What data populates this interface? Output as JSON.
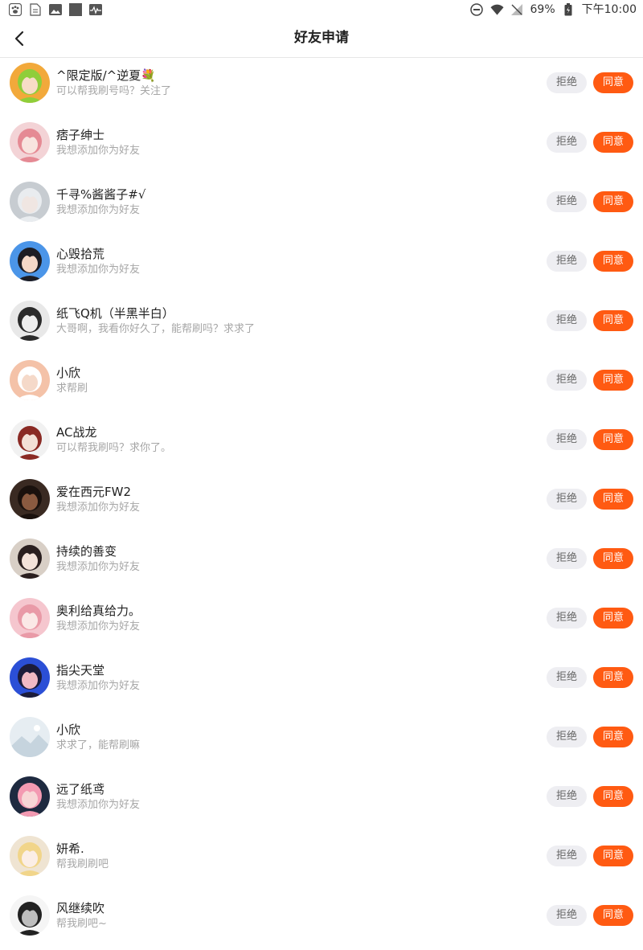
{
  "status_bar": {
    "left_icons": [
      "paw-app-icon",
      "document-icon",
      "image-icon",
      "gray-square-icon",
      "activity-icon"
    ],
    "right_icons": [
      "do-not-disturb-icon",
      "wifi-icon",
      "no-sim-icon",
      "battery-icon"
    ],
    "battery": "69%",
    "time": "下午10:00"
  },
  "header": {
    "title": "好友申请",
    "back_icon": "chevron-left-icon"
  },
  "buttons": {
    "reject_label": "拒绝",
    "accept_label": "同意"
  },
  "colors": {
    "accent": "#ff5a12",
    "reject_bg": "#eeeef2",
    "name_text": "#222222",
    "message_text": "#a6a6a6"
  },
  "requests": [
    {
      "name": "^限定版/^逆夏💐",
      "message": "可以帮我刷号吗？关注了",
      "avatar": "green-haired-anime-avatar"
    },
    {
      "name": "痞子绅士",
      "message": "我想添加你为好友",
      "avatar": "pink-anime-avatar"
    },
    {
      "name": "千寻%酱酱子#√",
      "message": "我想添加你为好友",
      "avatar": "white-haired-anime-avatar"
    },
    {
      "name": "心毁拾荒",
      "message": "我想添加你为好友",
      "avatar": "black-haired-girl-avatar"
    },
    {
      "name": "纸飞Q机（半黑半白）",
      "message": "大哥啊，我看你好久了，能帮刷吗？求求了",
      "avatar": "masked-boy-avatar"
    },
    {
      "name": "小欣",
      "message": "求帮刷",
      "avatar": "bear-hat-avatar"
    },
    {
      "name": "AC战龙",
      "message": "可以帮我刷吗？求你了。",
      "avatar": "red-white-hair-avatar"
    },
    {
      "name": "爱在西元FW2",
      "message": "我想添加你为好友",
      "avatar": "dark-skin-girl-avatar"
    },
    {
      "name": "持续的善变",
      "message": "我想添加你为好友",
      "avatar": "dark-haired-boy-avatar"
    },
    {
      "name": "奥利给真给力。",
      "message": "我想添加你为好友",
      "avatar": "pink-haired-girl-avatar"
    },
    {
      "name": "指尖天堂",
      "message": "我想添加你为好友",
      "avatar": "blue-pink-girl-avatar"
    },
    {
      "name": "小欣",
      "message": "求求了，能帮刷嘛",
      "avatar": "default-landscape-avatar"
    },
    {
      "name": "远了纸鸢",
      "message": "我想添加你为好友",
      "avatar": "pink-haired-dark-avatar"
    },
    {
      "name": "妍希.",
      "message": "帮我刷刷吧",
      "avatar": "blonde-girl-avatar"
    },
    {
      "name": "风继续吹",
      "message": "帮我刷吧~",
      "avatar": "black-white-figure-avatar"
    }
  ]
}
